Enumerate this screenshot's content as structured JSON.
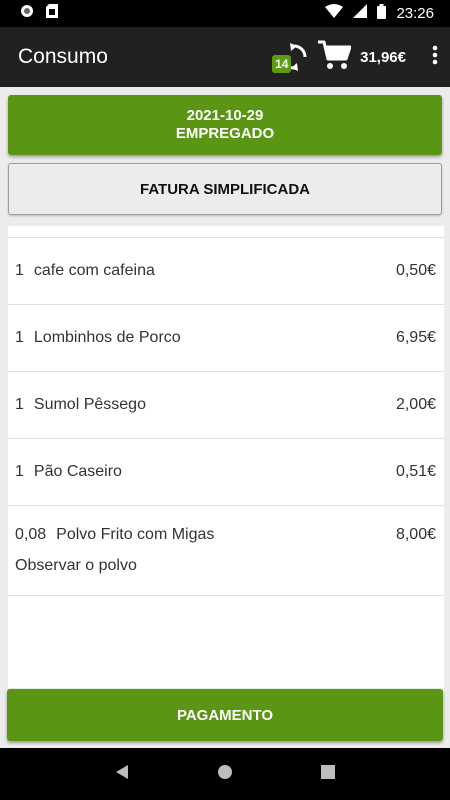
{
  "status_bar": {
    "time": "23:26"
  },
  "app_bar": {
    "title": "Consumo",
    "sync_count": "14",
    "cart_total": "31,96€"
  },
  "header_button": {
    "date": "2021-10-29",
    "employee": "EMPREGADO"
  },
  "invoice_type_button": {
    "label": "FATURA SIMPLIFICADA"
  },
  "items": [
    {
      "qty": "1",
      "name": "cafe com cafeina",
      "price": "0,50€"
    },
    {
      "qty": "1",
      "name": "Lombinhos de Porco",
      "price": "6,95€"
    },
    {
      "qty": "1",
      "name": "Sumol Pêssego",
      "price": "2,00€"
    },
    {
      "qty": "1",
      "name": "Pão Caseiro",
      "price": "0,51€"
    },
    {
      "qty": "0,08",
      "name": "Polvo Frito com Migas",
      "price": "8,00€",
      "note": "Observar o polvo"
    }
  ],
  "payment_button": {
    "label": "PAGAMENTO"
  },
  "colors": {
    "accent_green": "#5a9514",
    "app_bar": "#212121",
    "badge_green": "#5e9a14"
  }
}
